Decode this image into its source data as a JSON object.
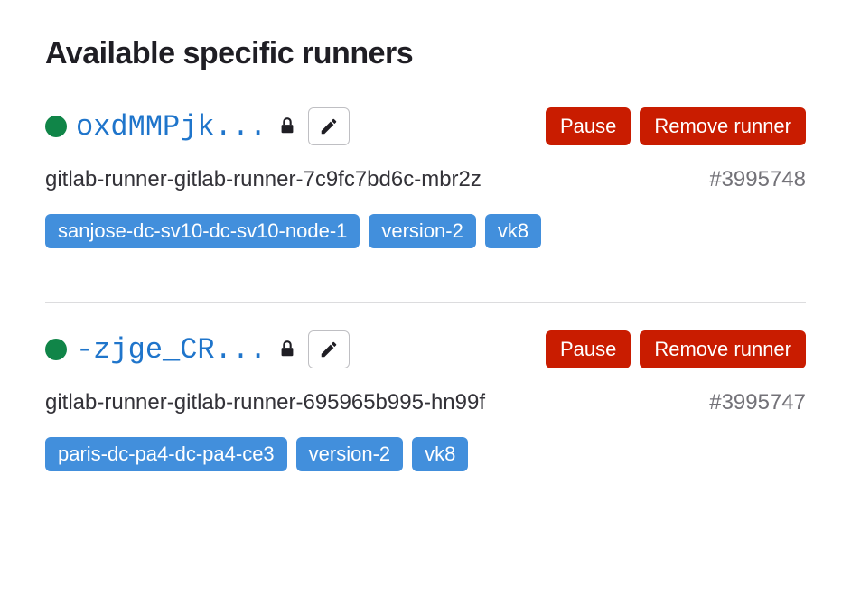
{
  "heading": "Available specific runners",
  "buttons": {
    "pause": "Pause",
    "remove": "Remove runner"
  },
  "runners": [
    {
      "token": "oxdMMPjk...",
      "description": "gitlab-runner-gitlab-runner-7c9fc7bd6c-mbr2z",
      "number": "#3995748",
      "tags": [
        "sanjose-dc-sv10-dc-sv10-node-1",
        "version-2",
        "vk8"
      ]
    },
    {
      "token": "-zjge_CR...",
      "description": "gitlab-runner-gitlab-runner-695965b995-hn99f",
      "number": "#3995747",
      "tags": [
        "paris-dc-pa4-dc-pa4-ce3",
        "version-2",
        "vk8"
      ]
    }
  ]
}
